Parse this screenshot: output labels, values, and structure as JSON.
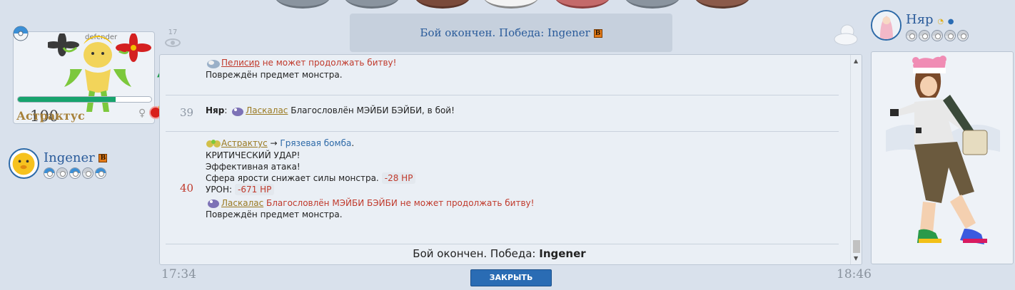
{
  "left_monster": {
    "tag": "defender",
    "level": "100",
    "name": "Астрактус",
    "hp_fraction": 0.73,
    "gender_icon": "female-symbol"
  },
  "left_player": {
    "name": "Ingener",
    "badge": "B",
    "balls": [
      "active",
      "empty",
      "active",
      "empty",
      "active"
    ]
  },
  "right_player": {
    "name": "Няр",
    "balls": [
      "empty",
      "empty",
      "empty",
      "empty",
      "empty"
    ]
  },
  "viewers": "17",
  "header": {
    "result_text": "Бой окончен. Победа: Ingener",
    "badge": "B"
  },
  "log": {
    "e38": {
      "mon": "Пелисир",
      "line1_rest": " не может продолжать битву!",
      "line2": "Повреждён предмет монстра."
    },
    "e39": {
      "num": "39",
      "speaker": "Няр",
      "mon": "Ласкалас",
      "text": " Благословлён МЭЙБИ БЭЙБИ, в бой!"
    },
    "e40": {
      "num": "40",
      "attacker": "Астрактус",
      "arrow": " → ",
      "move": "Грязевая бомба",
      "dot": ".",
      "crit": "КРИТИЧЕСКИЙ УДАР!",
      "effective": "Эффективная атака!",
      "sphere": "Сфера ярости снижает силы монстра.",
      "hp_loss": "-28 HP",
      "damage_label": "УРОН:",
      "damage": "-671 HP",
      "faint_mon": "Ласкалас",
      "faint_text": " Благословлён МЭЙБИ БЭЙБИ не может продолжать битву!",
      "item": "Повреждён предмет монстра."
    },
    "final_prefix": "Бой окончен. Победа: ",
    "final_winner": "Ingener"
  },
  "time_left": "17:34",
  "time_right": "18:46",
  "close_label": "ЗАКРЫТЬ",
  "colors": {
    "accent": "#2a6cb4",
    "hp": "#17a36d",
    "danger": "#c0392b",
    "name_gold": "#a7813a"
  }
}
